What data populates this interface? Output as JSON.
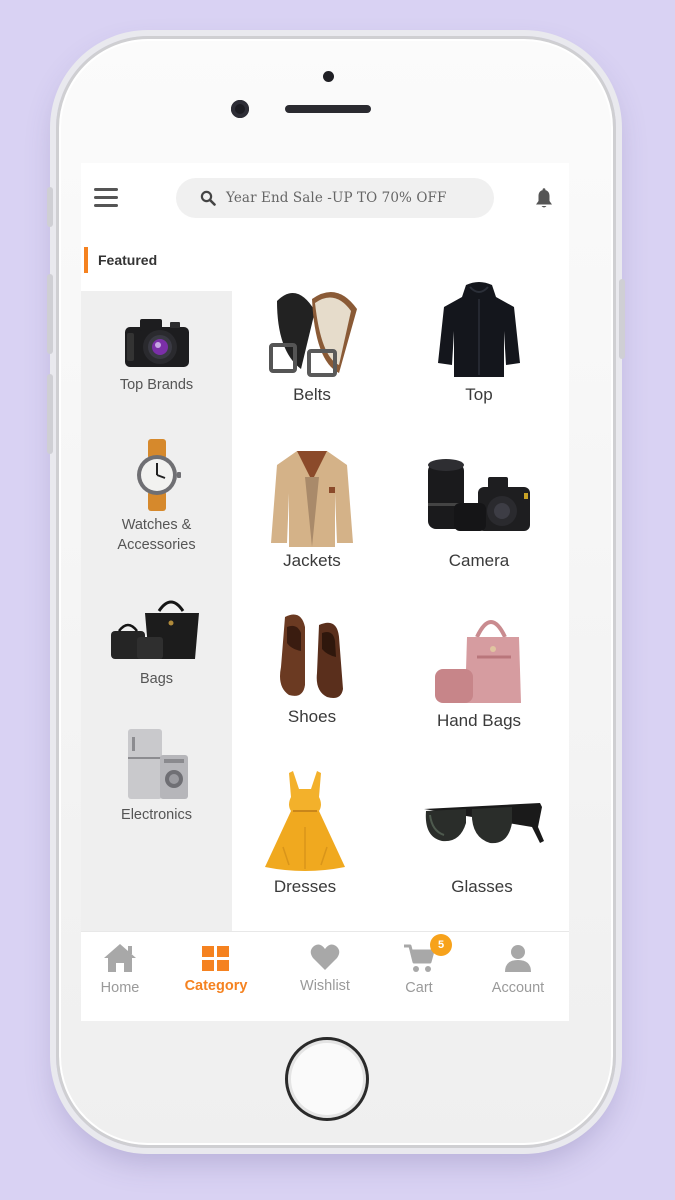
{
  "header": {
    "search_placeholder": "Year End Sale -UP TO 70% OFF"
  },
  "section": {
    "title": "Featured"
  },
  "sidebar": {
    "items": [
      {
        "label": "Top Brands"
      },
      {
        "label_line1": "Watches &",
        "label_line2": "Accessories"
      },
      {
        "label": "Bags"
      },
      {
        "label": "Electronics"
      }
    ]
  },
  "grid": {
    "items": [
      {
        "label": "Belts"
      },
      {
        "label": "Top"
      },
      {
        "label": "Jackets"
      },
      {
        "label": "Camera"
      },
      {
        "label": "Shoes"
      },
      {
        "label": "Hand Bags"
      },
      {
        "label": "Dresses"
      },
      {
        "label": "Glasses"
      }
    ]
  },
  "nav": {
    "items": [
      {
        "label": "Home"
      },
      {
        "label": "Category"
      },
      {
        "label": "Wishlist"
      },
      {
        "label": "Cart",
        "badge": "5"
      },
      {
        "label": "Account"
      }
    ]
  },
  "colors": {
    "accent": "#f58220",
    "badge": "#f7a21b",
    "background": "#d9d2f3",
    "sidebar_bg": "#efefef"
  }
}
